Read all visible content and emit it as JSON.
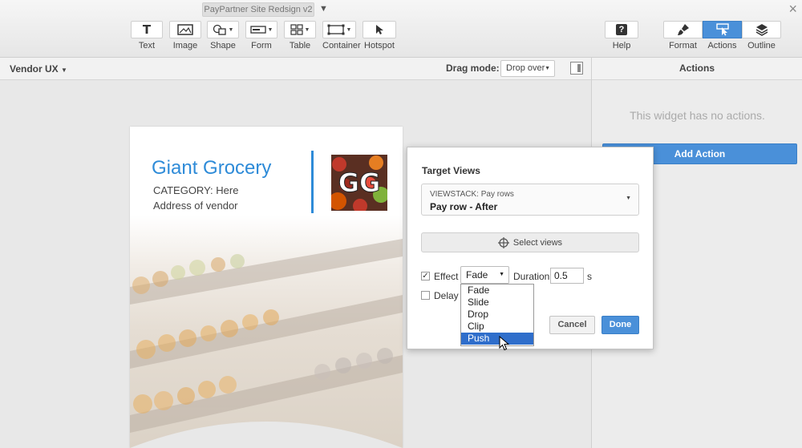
{
  "header": {
    "document_title": "PayPartner Site Redsign v2",
    "close_glyph": "×"
  },
  "toolbar": {
    "left_tools": [
      {
        "label": "Text",
        "icon": "text-icon",
        "glyph": "T"
      },
      {
        "label": "Image",
        "icon": "image-icon"
      },
      {
        "label": "Shape",
        "icon": "shape-icon"
      },
      {
        "label": "Form",
        "icon": "form-icon"
      },
      {
        "label": "Table",
        "icon": "table-icon"
      },
      {
        "label": "Container",
        "icon": "container-icon"
      },
      {
        "label": "Hotspot",
        "icon": "hotspot-icon"
      }
    ],
    "help": {
      "label": "Help",
      "icon": "help-icon",
      "glyph": "?"
    },
    "right_tools": [
      {
        "label": "Format",
        "icon": "brush-icon",
        "active": false
      },
      {
        "label": "Actions",
        "icon": "actions-icon",
        "active": true
      },
      {
        "label": "Outline",
        "icon": "layers-icon",
        "active": false
      }
    ],
    "active_color": "#4a90d9"
  },
  "subbar": {
    "page_select": "Vendor UX",
    "drag_mode_label": "Drag mode:",
    "drag_mode_value": "Drop over"
  },
  "canvas": {
    "vendor_name": "Giant Grocery",
    "category": "CATEGORY: Here",
    "address": "Address of vendor",
    "logo_text": "GG",
    "accent_color": "#2e8bd8"
  },
  "actions_panel": {
    "title": "Actions",
    "empty_message": "This widget has no actions.",
    "add_button": "Add Action"
  },
  "popup": {
    "title": "Target Views",
    "viewstack_label": "VIEWSTACK: Pay rows",
    "viewstack_value": "Pay row - After",
    "select_views": "Select views",
    "effect_label": "Effect",
    "effect_checked": true,
    "effect_value": "Fade",
    "effect_options": [
      "Fade",
      "Slide",
      "Drop",
      "Clip",
      "Push"
    ],
    "highlighted_option": "Push",
    "duration_label": "Duration",
    "duration_value": "0.5",
    "duration_unit": "s",
    "delay_label": "Delay",
    "delay_checked": false,
    "cancel": "Cancel",
    "done": "Done"
  }
}
